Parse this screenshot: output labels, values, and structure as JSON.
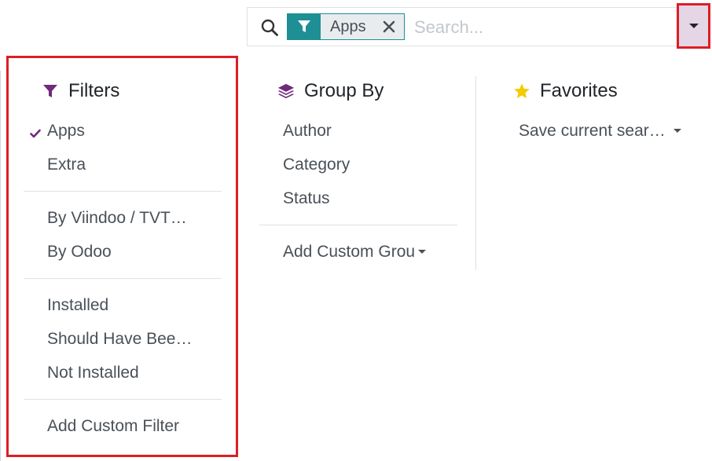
{
  "search": {
    "facet_value": "Apps",
    "placeholder": "Search..."
  },
  "filters": {
    "title": "Filters",
    "groups": [
      [
        {
          "label": "Apps",
          "checked": true
        },
        {
          "label": "Extra",
          "checked": false
        }
      ],
      [
        {
          "label": "By Viindoo / TVT…",
          "checked": false
        },
        {
          "label": "By Odoo",
          "checked": false
        }
      ],
      [
        {
          "label": "Installed",
          "checked": false
        },
        {
          "label": "Should Have Bee…",
          "checked": false
        },
        {
          "label": "Not Installed",
          "checked": false
        }
      ]
    ],
    "add_custom": "Add Custom Filter"
  },
  "group_by": {
    "title": "Group By",
    "items": [
      "Author",
      "Category",
      "Status"
    ],
    "add_custom": "Add Custom Grou"
  },
  "favorites": {
    "title": "Favorites",
    "save_current": "Save current sear…"
  },
  "colors": {
    "filter_icon": "#71297a",
    "facet_teal": "#1d8f95",
    "star": "#f3cc00",
    "highlight_red": "#dd1e25",
    "toggle_bg": "#e5d6e6"
  },
  "icons": {
    "search": "search-icon",
    "facet": "filter-icon",
    "remove": "close-icon",
    "toggle": "caret-down-icon",
    "filters": "filter-icon",
    "group_by": "layers-icon",
    "favorites": "star-icon",
    "check": "checkmark-icon"
  }
}
